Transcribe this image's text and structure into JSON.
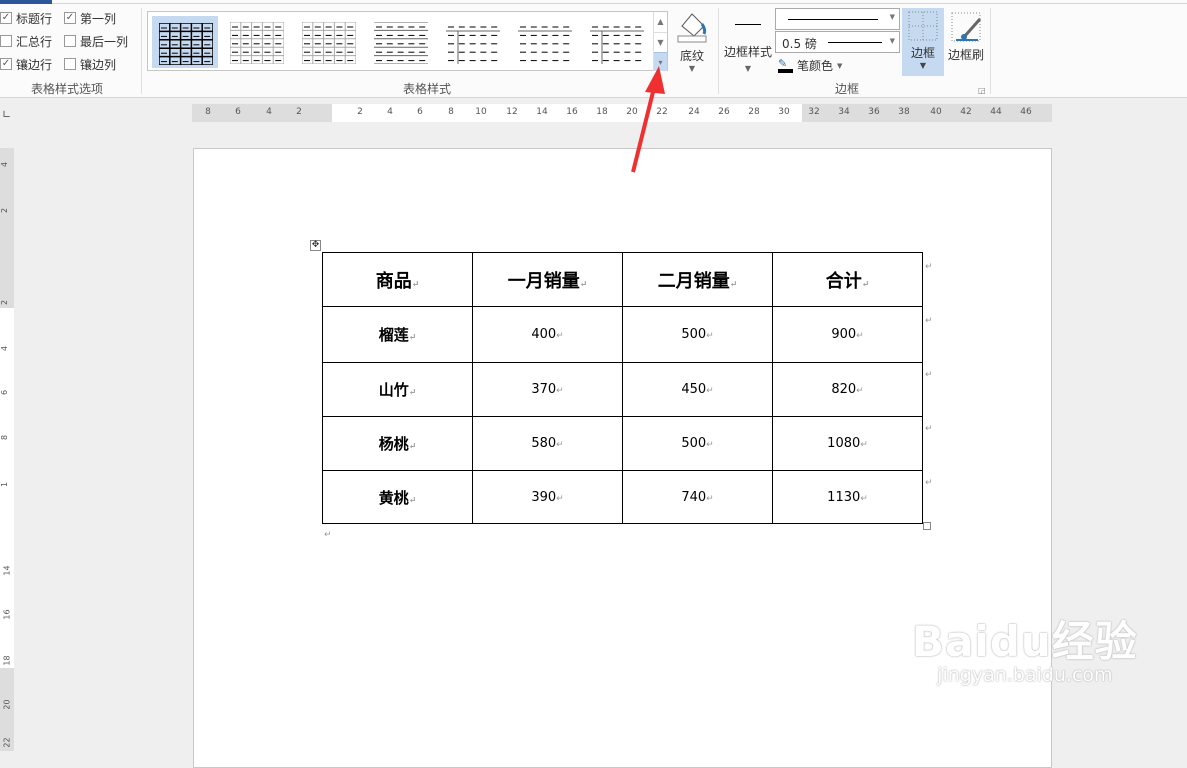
{
  "style_options": {
    "title": "表格样式选项",
    "items": [
      {
        "label": "标题行",
        "checked": true
      },
      {
        "label": "第一列",
        "checked": true
      },
      {
        "label": "汇总行",
        "checked": false
      },
      {
        "label": "最后一列",
        "checked": false
      },
      {
        "label": "镶边行",
        "checked": true
      },
      {
        "label": "镶边列",
        "checked": false
      }
    ]
  },
  "table_styles": {
    "title": "表格样式"
  },
  "shading": {
    "label": "底纹"
  },
  "borders": {
    "title": "边框",
    "border_styles": "边框样式",
    "weight": "0.5 磅",
    "pen_color": "笔颜色",
    "borders": "边框",
    "painter": "边框刷"
  },
  "ruler": {
    "h": [
      "8",
      "6",
      "4",
      "2",
      "2",
      "4",
      "6",
      "8",
      "10",
      "12",
      "14",
      "16",
      "18",
      "20",
      "22",
      "24",
      "26",
      "28",
      "30",
      "32",
      "34",
      "36",
      "38",
      "40",
      "42",
      "44",
      "46"
    ],
    "v": [
      "4",
      "2",
      "2",
      "4",
      "6",
      "8",
      "1",
      "14",
      "16",
      "18",
      "20",
      "22"
    ]
  },
  "table": {
    "header": [
      "商品",
      "一月销量",
      "二月销量",
      "合计"
    ],
    "rows": [
      [
        "榴莲",
        "400",
        "500",
        "900"
      ],
      [
        "山竹",
        "370",
        "450",
        "820"
      ],
      [
        "杨桃",
        "580",
        "500",
        "1080"
      ],
      [
        "黄桃",
        "390",
        "740",
        "1130"
      ]
    ]
  },
  "paragraph_mark": "↵",
  "watermark": {
    "logo": "Baidu经验",
    "url": "jingyan.baidu.com"
  }
}
